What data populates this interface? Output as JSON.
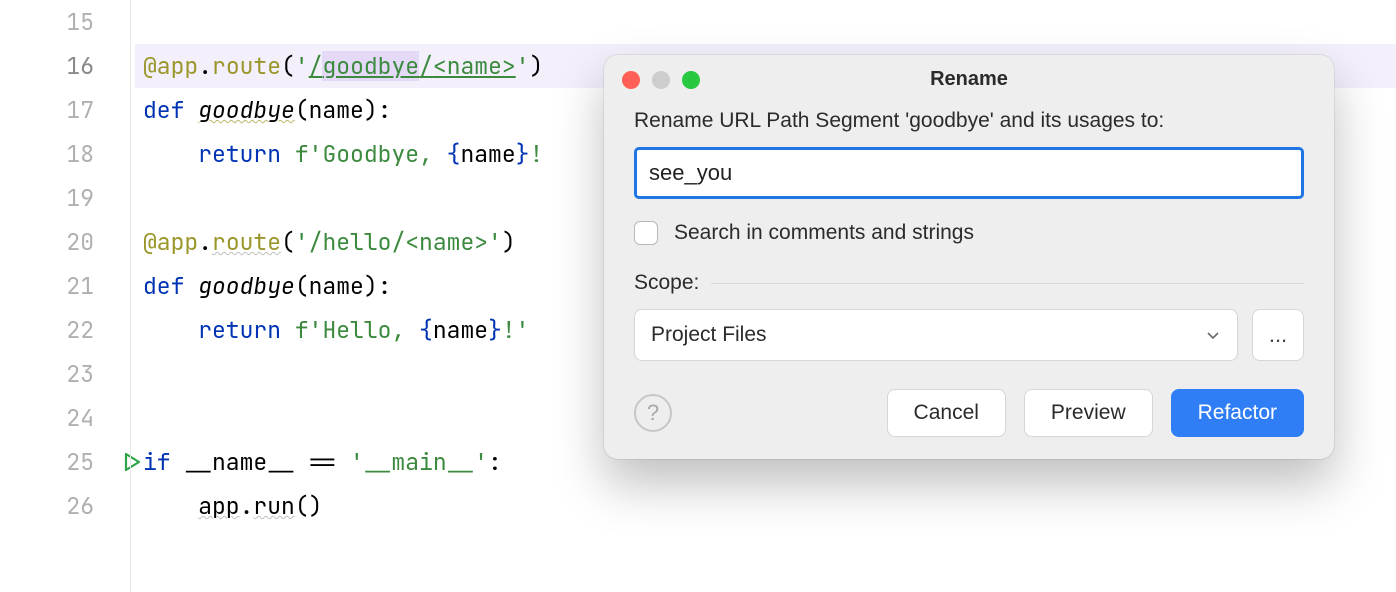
{
  "editor": {
    "lines": [
      "15",
      "16",
      "17",
      "18",
      "19",
      "20",
      "21",
      "22",
      "23",
      "24",
      "25",
      "26"
    ],
    "current_line": "16",
    "run_gutter_line": "25",
    "code": {
      "l16": {
        "decorator_prefix": "@app",
        "dot": ".",
        "route": "route",
        "open": "(",
        "s_q": "'",
        "s_slash": "/",
        "s_goodbye": "goodbye",
        "s_slash2": "/",
        "s_name": "<name>",
        "s_q2": "'",
        "close": ")"
      },
      "l17": {
        "kw": "def ",
        "fn": "goodbye",
        "open": "(",
        "param": "name",
        "close": "):"
      },
      "l18": {
        "kw": "return ",
        "f": "f",
        "q": "'",
        "text": "Goodbye, ",
        "lb": "{",
        "var": "name",
        "rb": "}",
        "text2": "!"
      },
      "l20": {
        "decorator_prefix": "@app",
        "dot": ".",
        "route": "route",
        "open": "(",
        "s_full": "'/hello/<name>'",
        "close": ")"
      },
      "l21": {
        "kw": "def ",
        "fn": "goodbye",
        "open": "(",
        "param": "name",
        "close": "):"
      },
      "l22": {
        "kw": "return ",
        "f": "f",
        "q": "'",
        "text": "Hello, ",
        "lb": "{",
        "var": "name",
        "rb": "}",
        "text2": "!'"
      },
      "l25": {
        "kw": "if ",
        "name": "__name__",
        "eq": " == ",
        "str": "'__main__'",
        "colon": ":"
      },
      "l26": {
        "app": "app",
        "dot": ".",
        "run": "run",
        "call": "()"
      }
    }
  },
  "dialog": {
    "title": "Rename",
    "prompt": "Rename URL Path Segment 'goodbye' and its usages to:",
    "input_value": "see_you",
    "checkbox_label": "Search in comments and strings",
    "scope_label": "Scope:",
    "scope_value": "Project Files",
    "more_label": "...",
    "help_label": "?",
    "buttons": {
      "cancel": "Cancel",
      "preview": "Preview",
      "refactor": "Refactor"
    }
  }
}
